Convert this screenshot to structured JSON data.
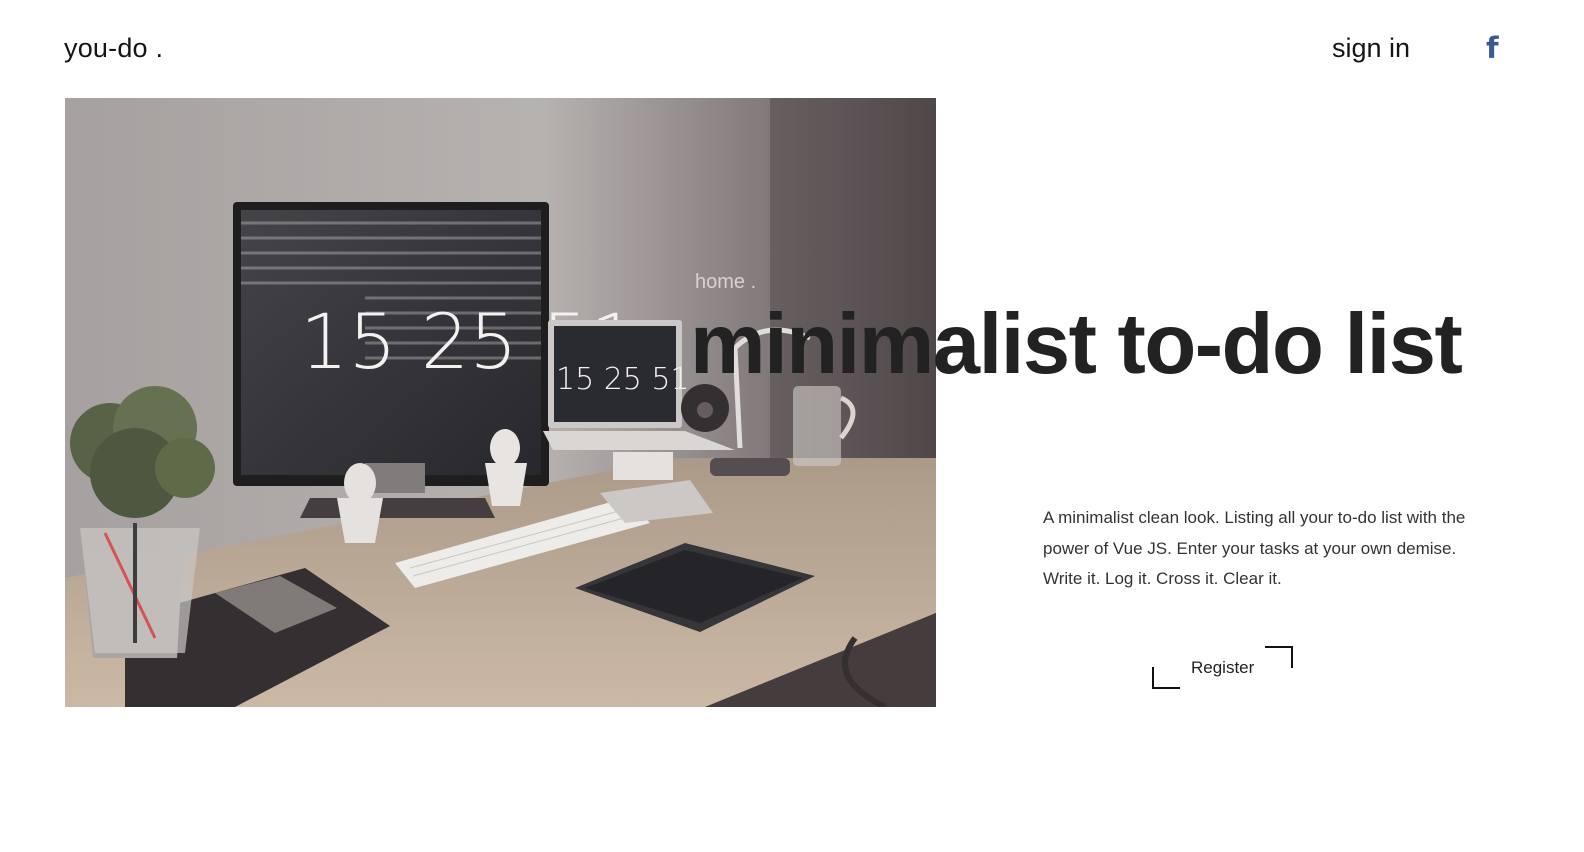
{
  "header": {
    "logo": "you-do .",
    "sign_in": "sign in",
    "facebook_glyph": "f",
    "facebook_icon": "facebook-icon"
  },
  "hero": {
    "home_label": "home .",
    "headline": "minimalist to-do list",
    "monitor_clock": "15 25 51",
    "laptop_clock": "15 25 51"
  },
  "intro": {
    "description": "A minimalist clean look. Listing all your to-do list with the power of Vue JS. Enter your tasks at your own demise. Write it. Log it. Cross it. Clear it."
  },
  "cta": {
    "register": "Register"
  },
  "colors": {
    "facebook": "#3b5998",
    "text": "#222222",
    "background": "#ffffff"
  }
}
